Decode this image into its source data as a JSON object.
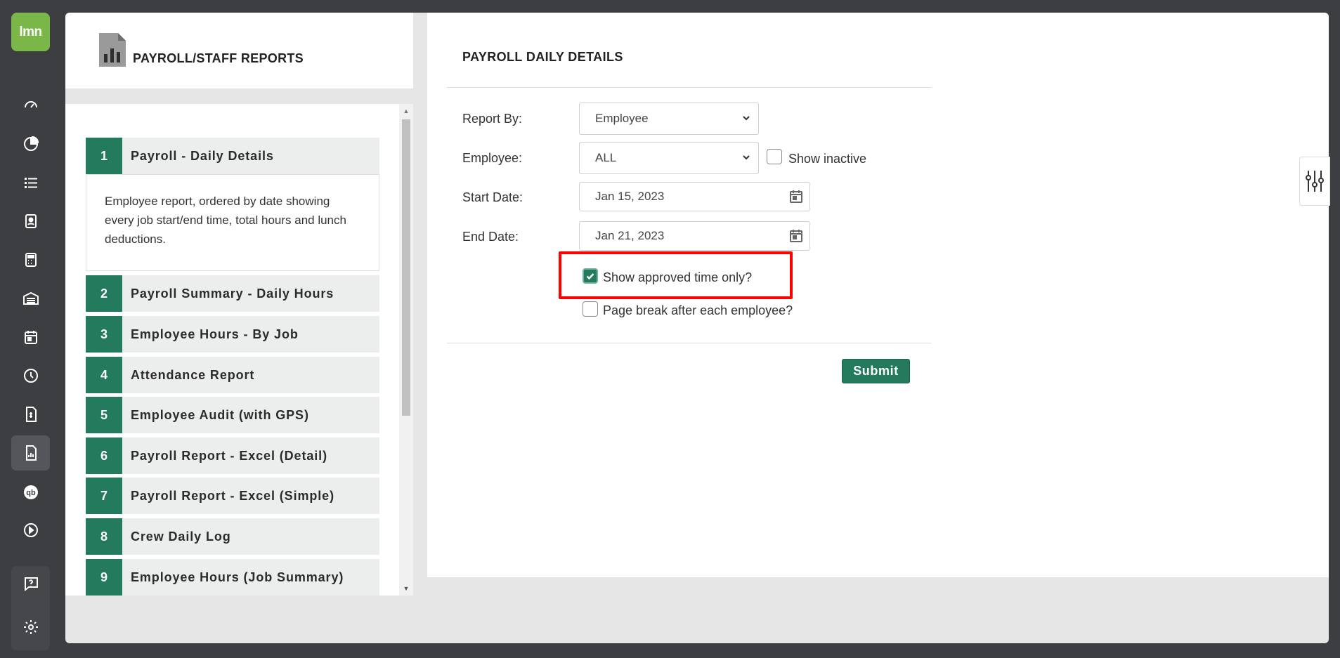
{
  "logo": {
    "text": "lmn"
  },
  "nav": {
    "items": [
      {
        "icon": "dashboard-icon"
      },
      {
        "icon": "pie-chart-icon"
      },
      {
        "icon": "list-icon"
      },
      {
        "icon": "contact-card-icon"
      },
      {
        "icon": "calculator-icon"
      },
      {
        "icon": "warehouse-icon"
      },
      {
        "icon": "calendar-icon"
      },
      {
        "icon": "clock-icon"
      },
      {
        "icon": "invoice-icon"
      },
      {
        "icon": "report-icon",
        "active": true
      },
      {
        "icon": "quickbooks-icon"
      },
      {
        "icon": "play-icon"
      }
    ],
    "bottom": [
      {
        "icon": "help-icon"
      },
      {
        "icon": "gear-icon"
      }
    ]
  },
  "reports_panel": {
    "title": "PAYROLL/STAFF REPORTS",
    "items": [
      {
        "num": "1",
        "label": "Payroll - Daily Details",
        "description": "Employee report, ordered by date showing every job start/end time, total hours and lunch deductions."
      },
      {
        "num": "2",
        "label": "Payroll Summary - Daily Hours"
      },
      {
        "num": "3",
        "label": "Employee Hours - By Job"
      },
      {
        "num": "4",
        "label": "Attendance Report"
      },
      {
        "num": "5",
        "label": "Employee Audit (with GPS)"
      },
      {
        "num": "6",
        "label": "Payroll Report - Excel (Detail)"
      },
      {
        "num": "7",
        "label": "Payroll Report - Excel (Simple)"
      },
      {
        "num": "8",
        "label": "Crew Daily Log"
      },
      {
        "num": "9",
        "label": "Employee Hours (Job Summary)"
      }
    ]
  },
  "form": {
    "title": "PAYROLL DAILY DETAILS",
    "report_by": {
      "label": "Report By:",
      "value": "Employee"
    },
    "employee": {
      "label": "Employee:",
      "value": "ALL"
    },
    "show_inactive": {
      "label": "Show inactive",
      "checked": false
    },
    "start_date": {
      "label": "Start Date:",
      "value": "Jan 15, 2023"
    },
    "end_date": {
      "label": "End Date:",
      "value": "Jan 21, 2023"
    },
    "approved_only": {
      "label": "Show approved time only?",
      "checked": true
    },
    "page_break": {
      "label": "Page break after each employee?",
      "checked": false
    },
    "submit_label": "Submit"
  },
  "colors": {
    "accent": "#237a5d",
    "logo": "#7ab648",
    "highlight": "#ff0000",
    "nav_bg": "#3d3e42"
  }
}
